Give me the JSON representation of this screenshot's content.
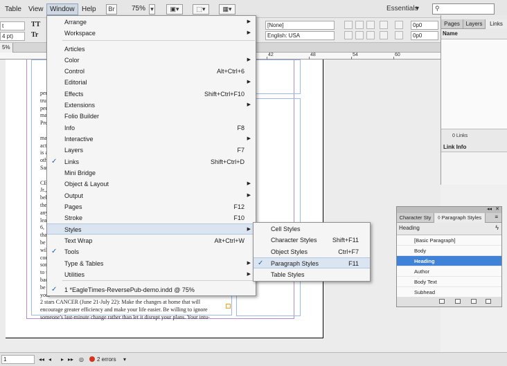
{
  "menubar": {
    "items": [
      "Table",
      "View",
      "Window",
      "Help"
    ],
    "br_label": "Br",
    "zoom": "75%",
    "workspace": "Essentials"
  },
  "controlbar": {
    "font_style_a": "t",
    "font_size_a": "4 pt)",
    "tt_upper": "TT",
    "tt_sub": "Tr",
    "char_style": "[None]",
    "language": "English: USA",
    "indent_fields": [
      "0p0",
      "0p0",
      "0p0",
      "0p0"
    ]
  },
  "doc": {
    "tab_label": "5%",
    "ruler_marks": [
      "42",
      "48",
      "54",
      "60"
    ],
    "text_lines": [
      "perso",
      "true ",
      "perio",
      "mana",
      "Presi",
      "",
      "mana",
      "activ",
      "is als",
      "othe",
      "Sanb",
      "",
      "CELI",
      "Jr., 4",
      "beha",
      "the p",
      "any c",
      "lead ",
      "6, 14",
      "that ",
      "be co",
      "will c",
      "conc",
      "some",
      "to th",
      "back",
      "be ac",
      "your",
      "2 stars   CANCER (June 21-July 22): Make the changes at home that will",
      "encourage greater efficiency and make your life easier. Be willing to ignore",
      "someone's last-minute change rather than let it disrupt your plans. Your intu-"
    ]
  },
  "window_menu": {
    "items": [
      {
        "label": "Arrange",
        "shortcut": "",
        "submenu": true,
        "checked": false
      },
      {
        "label": "Workspace",
        "shortcut": "",
        "submenu": true,
        "checked": false
      },
      {
        "label": "Articles",
        "shortcut": "",
        "submenu": false,
        "checked": false
      },
      {
        "label": "Color",
        "shortcut": "",
        "submenu": true,
        "checked": false
      },
      {
        "label": "Control",
        "shortcut": "Alt+Ctrl+6",
        "submenu": false,
        "checked": false
      },
      {
        "label": "Editorial",
        "shortcut": "",
        "submenu": true,
        "checked": false
      },
      {
        "label": "Effects",
        "shortcut": "Shift+Ctrl+F10",
        "submenu": false,
        "checked": false
      },
      {
        "label": "Extensions",
        "shortcut": "",
        "submenu": true,
        "checked": false
      },
      {
        "label": "Folio Builder",
        "shortcut": "",
        "submenu": false,
        "checked": false
      },
      {
        "label": "Info",
        "shortcut": "F8",
        "submenu": false,
        "checked": false
      },
      {
        "label": "Interactive",
        "shortcut": "",
        "submenu": true,
        "checked": false
      },
      {
        "label": "Layers",
        "shortcut": "F7",
        "submenu": false,
        "checked": false
      },
      {
        "label": "Links",
        "shortcut": "Shift+Ctrl+D",
        "submenu": false,
        "checked": true
      },
      {
        "label": "Mini Bridge",
        "shortcut": "",
        "submenu": false,
        "checked": false
      },
      {
        "label": "Object & Layout",
        "shortcut": "",
        "submenu": true,
        "checked": false
      },
      {
        "label": "Output",
        "shortcut": "",
        "submenu": true,
        "checked": false
      },
      {
        "label": "Pages",
        "shortcut": "F12",
        "submenu": false,
        "checked": false
      },
      {
        "label": "Stroke",
        "shortcut": "F10",
        "submenu": false,
        "checked": false
      },
      {
        "label": "Styles",
        "shortcut": "",
        "submenu": true,
        "checked": false
      },
      {
        "label": "Text Wrap",
        "shortcut": "Alt+Ctrl+W",
        "submenu": false,
        "checked": false
      },
      {
        "label": "Tools",
        "shortcut": "",
        "submenu": false,
        "checked": true
      },
      {
        "label": "Type & Tables",
        "shortcut": "",
        "submenu": true,
        "checked": false
      },
      {
        "label": "Utilities",
        "shortcut": "",
        "submenu": true,
        "checked": false
      },
      {
        "label": "1 *EagleTimes-ReversePub-demo.indd @ 75%",
        "shortcut": "",
        "submenu": false,
        "checked": true
      }
    ]
  },
  "styles_submenu": {
    "items": [
      {
        "label": "Cell Styles",
        "shortcut": "",
        "checked": false
      },
      {
        "label": "Character Styles",
        "shortcut": "Shift+F11",
        "checked": false
      },
      {
        "label": "Object Styles",
        "shortcut": "Ctrl+F7",
        "checked": false
      },
      {
        "label": "Paragraph Styles",
        "shortcut": "F11",
        "checked": true
      },
      {
        "label": "Table Styles",
        "shortcut": "",
        "checked": false
      }
    ]
  },
  "links_panel": {
    "tabs": [
      "Pages",
      "Layers",
      "Links"
    ],
    "column_header": "Name",
    "count": "0 Links",
    "info_header": "Link Info"
  },
  "paragraph_styles_panel": {
    "tabs": [
      "Character Sty",
      "◊ Paragraph Styles"
    ],
    "current_style": "Heading",
    "styles": [
      "[Basic Paragraph]",
      "Body",
      "Heading",
      "Author",
      "Body Text",
      "Subhead"
    ],
    "selected_index": 2
  },
  "statusbar": {
    "page": "1",
    "errors": "2 errors"
  },
  "colors": {
    "accent": "#3f82d8",
    "menu_highlight": "#dbe5f1",
    "error": "#d6331f"
  }
}
